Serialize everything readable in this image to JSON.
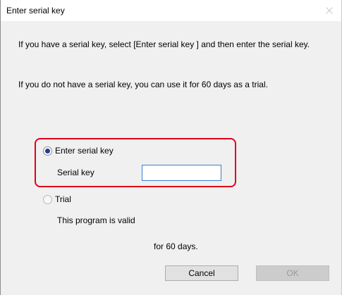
{
  "window": {
    "title": "Enter serial key"
  },
  "instructions": {
    "line1": "If you have a serial key, select [Enter serial key ] and then enter the serial key.",
    "line2": "If you do not have  a serial key, you can use it for 60 days as a trial."
  },
  "options": {
    "serial": {
      "label": "Enter serial key",
      "selected": true
    },
    "serial_key_field": {
      "label": "Serial key",
      "value": ""
    },
    "trial": {
      "label": "Trial",
      "selected": false,
      "text1": "This program is valid",
      "text2": "for 60 days."
    }
  },
  "buttons": {
    "cancel": "Cancel",
    "ok": "OK"
  },
  "colors": {
    "highlight": "#e0001b",
    "input_border": "#3a7bd5",
    "radio_dot": "#1f3f8e"
  }
}
